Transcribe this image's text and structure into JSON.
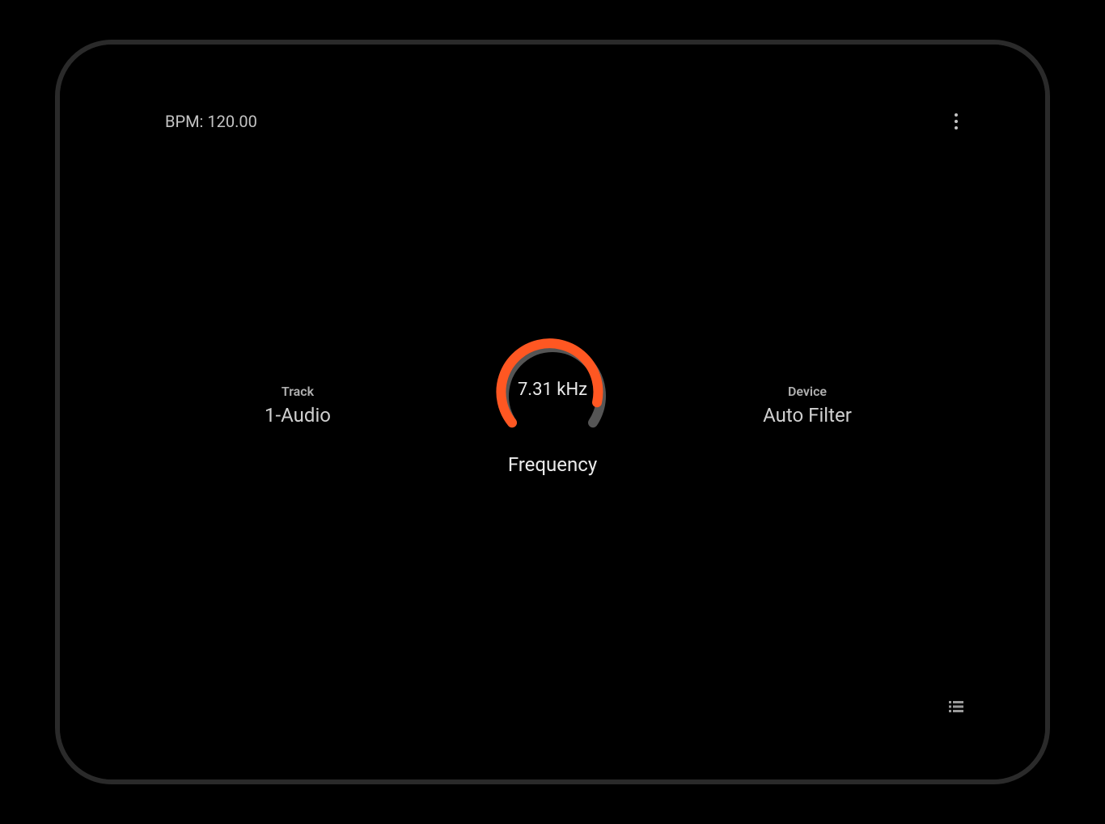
{
  "header": {
    "bpm_text": "BPM: 120.00"
  },
  "track": {
    "label": "Track",
    "value": "1-Audio"
  },
  "knob": {
    "value": "7.31 kHz",
    "label": "Frequency",
    "fill_percent": 0.85,
    "active_color": "#ff5722",
    "inactive_color": "#555555"
  },
  "device": {
    "label": "Device",
    "value": "Auto Filter"
  }
}
